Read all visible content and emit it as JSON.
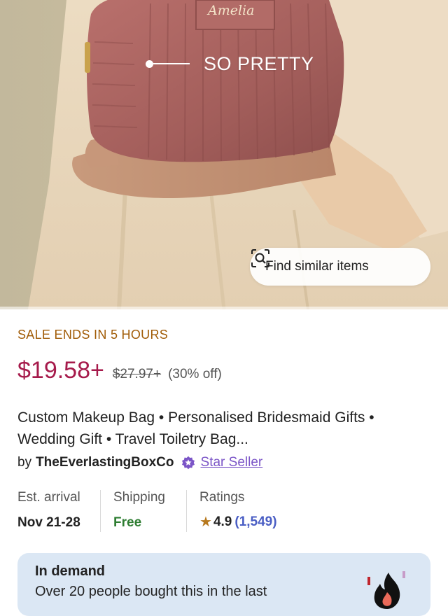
{
  "hero": {
    "overlay_caption": "SO PRETTY",
    "bag_name_embroidery": "Amelia",
    "find_similar_label": "Find similar items",
    "find_similar_icon": "camera-scan-icon"
  },
  "product": {
    "sale_banner": "SALE ENDS IN 5 HOURS",
    "price_current": "$19.58+",
    "price_original": "$27.97+",
    "discount": "(30% off)",
    "title": "Custom Makeup Bag • Personalised Bridesmaid Gifts • Wedding Gift • Travel Toiletry Bag...",
    "seller_prefix": "by",
    "seller_name": "TheEverlastingBoxCo",
    "star_seller_label": "Star Seller",
    "star_seller_icon": "star-seller-badge-icon"
  },
  "info": {
    "arrival_label": "Est. arrival",
    "arrival_value": "Nov 21-28",
    "shipping_label": "Shipping",
    "shipping_value": "Free",
    "ratings_label": "Ratings",
    "rating_star": "★",
    "rating_value": "4.9",
    "rating_count": "(1,549)"
  },
  "demand": {
    "title": "In demand",
    "text": "Over 20 people bought this in the last",
    "icon": "fire-icon"
  },
  "colors": {
    "sale_text": "#a15c07",
    "price": "#a61a4b",
    "star_seller": "#7b55c7",
    "free_shipping": "#2e7d32",
    "rating_count": "#4a5ec4",
    "demand_bg": "#dbe7f4"
  }
}
